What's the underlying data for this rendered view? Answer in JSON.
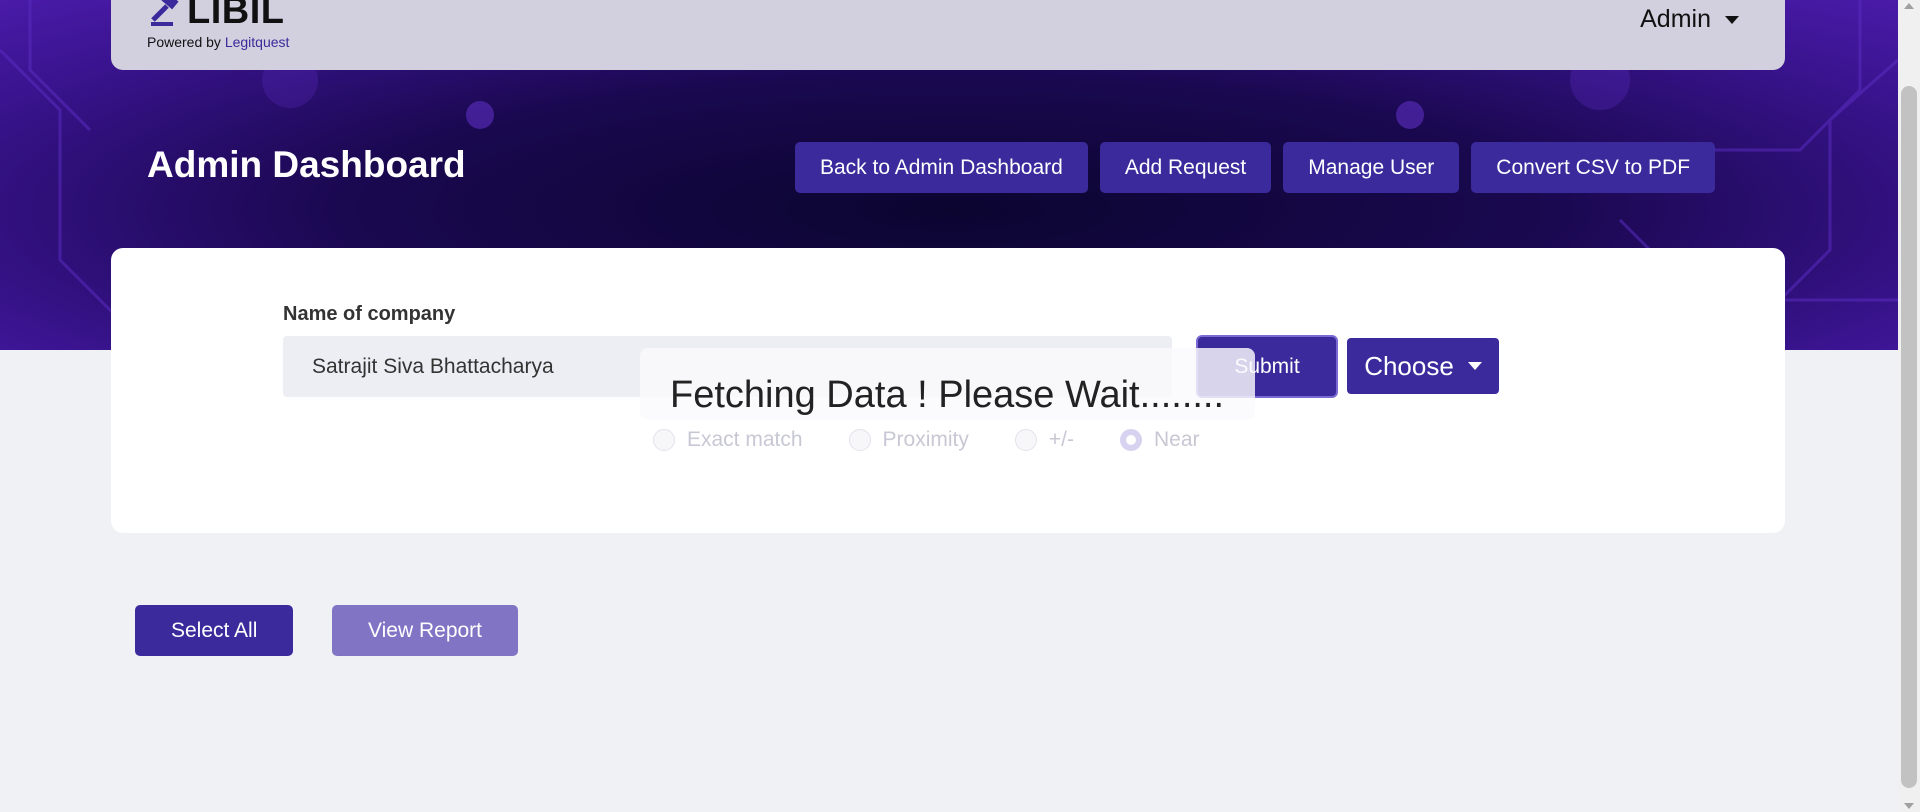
{
  "brand": {
    "name": "LIBIL",
    "powered_prefix": "Powered by",
    "powered_link": "Legitquest",
    "logo_icon": "gavel-icon"
  },
  "user_menu": {
    "label": "Admin",
    "icon": "chevron-down-icon"
  },
  "header": {
    "title": "Admin Dashboard",
    "buttons": [
      {
        "label": "Back to Admin Dashboard"
      },
      {
        "label": "Add Request"
      },
      {
        "label": "Manage User"
      },
      {
        "label": "Convert CSV to PDF"
      }
    ]
  },
  "form": {
    "company_label": "Name of company",
    "company_value": "Satrajit Siva Bhattacharya",
    "submit_label": "Submit",
    "choose_label": "Choose",
    "match_options": [
      {
        "label": "Exact match",
        "checked": false
      },
      {
        "label": "Proximity",
        "checked": false
      },
      {
        "label": "+/-",
        "checked": false
      },
      {
        "label": "Near",
        "checked": true
      }
    ]
  },
  "loading": {
    "message": "Fetching Data ! Please Wait........"
  },
  "actions": {
    "select_all_label": "Select All",
    "view_report_label": "View Report"
  },
  "colors": {
    "primary": "#3b2a9c",
    "primary_light": "#8174c4",
    "topbar_bg": "#d2cfdf",
    "page_bg": "#f0f1f5",
    "hero_dark": "#0b0530",
    "hero_purple": "#4a1ba8"
  }
}
